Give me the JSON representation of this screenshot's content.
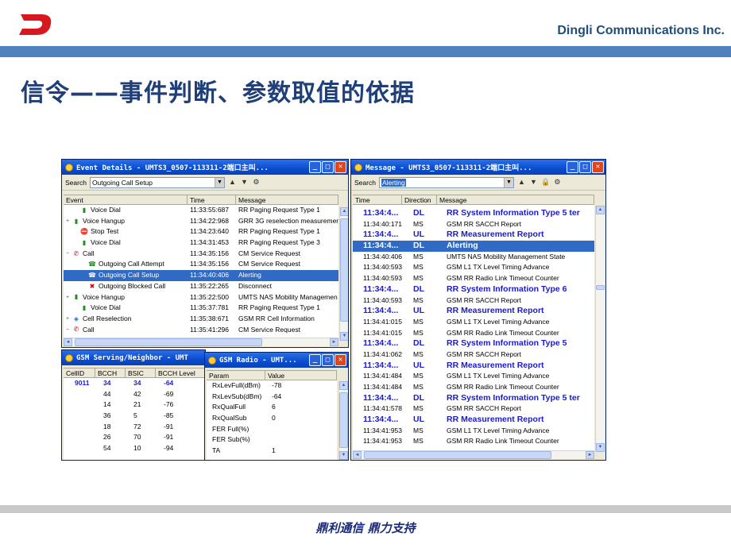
{
  "slide": {
    "company": "Dingli Communications Inc.",
    "title": "信令——事件判断、参数取值的依据",
    "footer": "鼎利通信  鼎力支持",
    "colors": {
      "topbar": "#4f81bd",
      "title": "#1f3f7a",
      "logo": "#d7181f"
    }
  },
  "event_details": {
    "title": "Event Details - UMTS3_0507-113311-2端口主叫...",
    "search_label": "Search",
    "search_value": "Outgoing Call Setup",
    "toolbar_icons": [
      "up-arrow-icon",
      "down-arrow-icon",
      "filter-icon"
    ],
    "columns": [
      "Event",
      "Time",
      "Message"
    ],
    "rows": [
      {
        "name": "Voice Dial",
        "time": "11:33:55:687",
        "msg": "RR Paging Request Type 1",
        "icon": "bars-icon",
        "indent": 1,
        "expander": "",
        "selected": false
      },
      {
        "name": "Voice Hangup",
        "time": "11:34:22:968",
        "msg": "GRR 3G reselection measuremen",
        "icon": "bars-icon",
        "indent": 0,
        "expander": "+",
        "selected": false
      },
      {
        "name": "Stop Test",
        "time": "11:34:23:640",
        "msg": "RR Paging Request Type 1",
        "icon": "stop-icon",
        "indent": 1,
        "expander": "",
        "selected": false
      },
      {
        "name": "Voice Dial",
        "time": "11:34:31:453",
        "msg": "RR Paging Request Type 3",
        "icon": "bars-icon",
        "indent": 1,
        "expander": "",
        "selected": false
      },
      {
        "name": "Call",
        "time": "11:34:35:156",
        "msg": "CM Service Request",
        "icon": "call-icon",
        "indent": 0,
        "expander": "−",
        "selected": false
      },
      {
        "name": "Outgoing Call Attempt",
        "time": "11:34:35:156",
        "msg": "CM Service Request",
        "icon": "phone-icon",
        "indent": 2,
        "expander": "",
        "selected": false
      },
      {
        "name": "Outgoing Call Setup",
        "time": "11:34:40:406",
        "msg": "Alerting",
        "icon": "phone-icon",
        "indent": 2,
        "expander": "",
        "selected": true
      },
      {
        "name": "Outgoing Blocked Call",
        "time": "11:35:22:265",
        "msg": "Disconnect",
        "icon": "blocked-icon",
        "indent": 2,
        "expander": "",
        "selected": false
      },
      {
        "name": "Voice Hangup",
        "time": "11:35:22:500",
        "msg": "UMTS NAS Mobility Managemen",
        "icon": "bars-icon",
        "indent": 0,
        "expander": "+",
        "selected": false
      },
      {
        "name": "Voice Dial",
        "time": "11:35:37:781",
        "msg": "RR Paging Request Type 1",
        "icon": "bars-icon",
        "indent": 1,
        "expander": "",
        "selected": false
      },
      {
        "name": "Cell Reselection",
        "time": "11:35:38:671",
        "msg": "GSM RR Cell Information",
        "icon": "cell-icon",
        "indent": 0,
        "expander": "+",
        "selected": false
      },
      {
        "name": "Call",
        "time": "11:35:41:296",
        "msg": "CM Service Request",
        "icon": "call-icon",
        "indent": 0,
        "expander": "−",
        "selected": false
      }
    ]
  },
  "gsm_serving": {
    "title": "GSM Serving/Neighbor - UMT",
    "columns": [
      "CellID",
      "BCCH",
      "BSIC",
      "BCCH Level"
    ],
    "rows": [
      {
        "cellid": "9011",
        "bcch": "34",
        "bsic": "34",
        "level": "-64",
        "bold": true
      },
      {
        "cellid": "",
        "bcch": "44",
        "bsic": "42",
        "level": "-69",
        "bold": false
      },
      {
        "cellid": "",
        "bcch": "14",
        "bsic": "21",
        "level": "-76",
        "bold": false
      },
      {
        "cellid": "",
        "bcch": "36",
        "bsic": "5",
        "level": "-85",
        "bold": false
      },
      {
        "cellid": "",
        "bcch": "18",
        "bsic": "72",
        "level": "-91",
        "bold": false
      },
      {
        "cellid": "",
        "bcch": "26",
        "bsic": "70",
        "level": "-91",
        "bold": false
      },
      {
        "cellid": "",
        "bcch": "54",
        "bsic": "10",
        "level": "-94",
        "bold": false
      }
    ]
  },
  "gsm_radio": {
    "title": "GSM Radio - UMT...",
    "columns": [
      "Param",
      "Value"
    ],
    "rows": [
      {
        "param": "RxLevFull(dBm)",
        "value": "-78"
      },
      {
        "param": "RxLevSub(dBm)",
        "value": "-64"
      },
      {
        "param": "RxQualFull",
        "value": "6"
      },
      {
        "param": "RxQualSub",
        "value": "0"
      },
      {
        "param": "FER Full(%)",
        "value": ""
      },
      {
        "param": "FER Sub(%)",
        "value": ""
      },
      {
        "param": "TA",
        "value": "1"
      }
    ]
  },
  "message": {
    "title": "Message - UMTS3_0507-113311-2端口主叫...",
    "search_label": "Search",
    "search_value": "Alerting",
    "toolbar_icons": [
      "up-arrow-icon",
      "down-arrow-icon",
      "lock-icon",
      "filter-icon"
    ],
    "columns": [
      "Time",
      "Direction",
      "Message"
    ],
    "rows": [
      {
        "time": "11:34:4...",
        "dir": "DL",
        "msg": "RR System Information Type 5 ter",
        "big": true,
        "selected": false
      },
      {
        "time": "11:34:40:171",
        "dir": "MS",
        "msg": "GSM RR SACCH Report",
        "big": false,
        "selected": false
      },
      {
        "time": "11:34:4...",
        "dir": "UL",
        "msg": "RR Measurement Report",
        "big": true,
        "selected": false
      },
      {
        "time": "11:34:4...",
        "dir": "DL",
        "msg": "Alerting",
        "big": true,
        "selected": true
      },
      {
        "time": "11:34:40:406",
        "dir": "MS",
        "msg": "UMTS NAS Mobility Management State",
        "big": false,
        "selected": false
      },
      {
        "time": "11:34:40:593",
        "dir": "MS",
        "msg": "GSM L1 TX Level Timing Advance",
        "big": false,
        "selected": false
      },
      {
        "time": "11:34:40:593",
        "dir": "MS",
        "msg": "GSM RR Radio Link Timeout Counter",
        "big": false,
        "selected": false
      },
      {
        "time": "11:34:4...",
        "dir": "DL",
        "msg": "RR System Information Type 6",
        "big": true,
        "selected": false
      },
      {
        "time": "11:34:40:593",
        "dir": "MS",
        "msg": "GSM RR SACCH Report",
        "big": false,
        "selected": false
      },
      {
        "time": "11:34:4...",
        "dir": "UL",
        "msg": "RR Measurement Report",
        "big": true,
        "selected": false
      },
      {
        "time": "11:34:41:015",
        "dir": "MS",
        "msg": "GSM L1 TX Level Timing Advance",
        "big": false,
        "selected": false
      },
      {
        "time": "11:34:41:015",
        "dir": "MS",
        "msg": "GSM RR Radio Link Timeout Counter",
        "big": false,
        "selected": false
      },
      {
        "time": "11:34:4...",
        "dir": "DL",
        "msg": "RR System Information Type 5",
        "big": true,
        "selected": false
      },
      {
        "time": "11:34:41:062",
        "dir": "MS",
        "msg": "GSM RR SACCH Report",
        "big": false,
        "selected": false
      },
      {
        "time": "11:34:4...",
        "dir": "UL",
        "msg": "RR Measurement Report",
        "big": true,
        "selected": false
      },
      {
        "time": "11:34:41:484",
        "dir": "MS",
        "msg": "GSM L1 TX Level Timing Advance",
        "big": false,
        "selected": false
      },
      {
        "time": "11:34:41:484",
        "dir": "MS",
        "msg": "GSM RR Radio Link Timeout Counter",
        "big": false,
        "selected": false
      },
      {
        "time": "11:34:4...",
        "dir": "DL",
        "msg": "RR System Information Type 5 ter",
        "big": true,
        "selected": false
      },
      {
        "time": "11:34:41:578",
        "dir": "MS",
        "msg": "GSM RR SACCH Report",
        "big": false,
        "selected": false
      },
      {
        "time": "11:34:4...",
        "dir": "UL",
        "msg": "RR Measurement Report",
        "big": true,
        "selected": false
      },
      {
        "time": "11:34:41:953",
        "dir": "MS",
        "msg": "GSM L1 TX Level Timing Advance",
        "big": false,
        "selected": false
      },
      {
        "time": "11:34:41:953",
        "dir": "MS",
        "msg": "GSM RR Radio Link Timeout Counter",
        "big": false,
        "selected": false
      }
    ]
  }
}
